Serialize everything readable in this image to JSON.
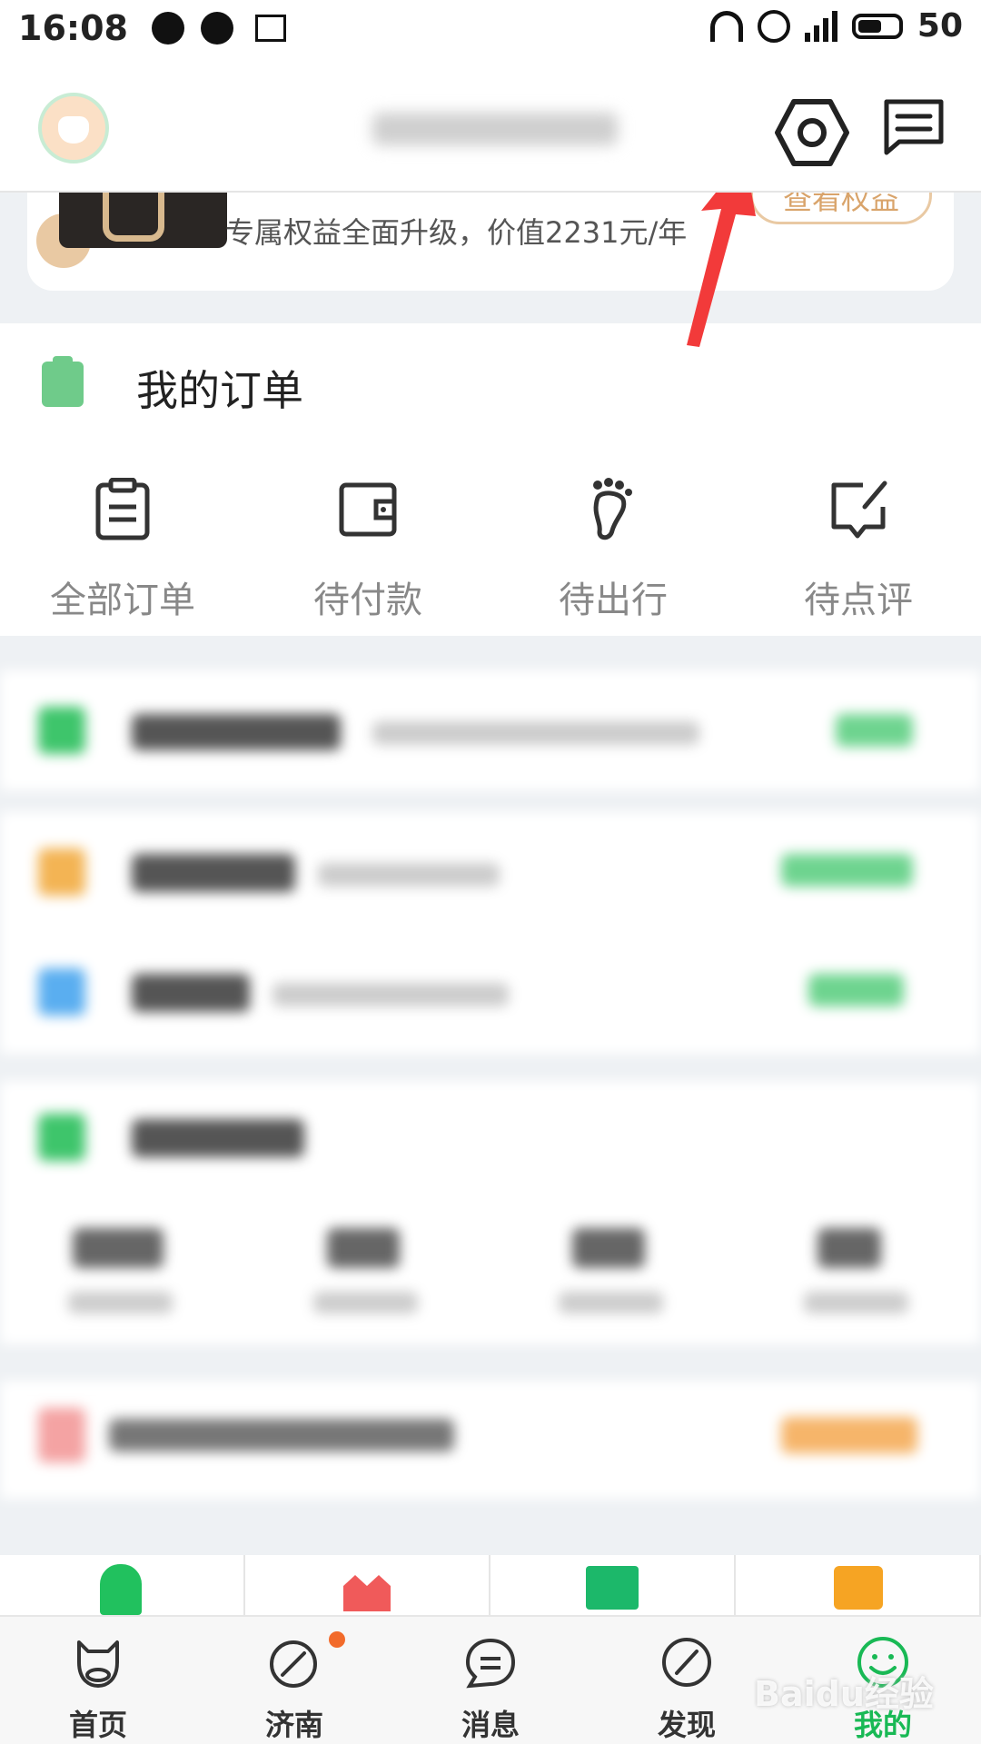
{
  "status_bar": {
    "time": "16:08",
    "battery": "50",
    "icons": [
      "wechat-icon",
      "wechat-icon",
      "news-icon",
      "headset-icon",
      "alarm-icon",
      "4g-signal-icon",
      "battery-icon"
    ]
  },
  "header": {
    "avatar_icon": "cow-avatar-icon",
    "settings_icon": "hexagon-settings-icon",
    "message_icon": "message-icon"
  },
  "vip_card": {
    "subtitle": "专属权益全面升级，价值2231元/年",
    "button": "查看权益"
  },
  "orders": {
    "title": "我的订单",
    "items": [
      {
        "label": "全部订单",
        "icon": "clipboard-icon"
      },
      {
        "label": "待付款",
        "icon": "wallet-icon"
      },
      {
        "label": "待出行",
        "icon": "footprint-icon"
      },
      {
        "label": "待点评",
        "icon": "comment-edit-icon"
      }
    ]
  },
  "tab_bar": {
    "items": [
      {
        "label": "首页",
        "icon": "cow-home-icon"
      },
      {
        "label": "济南",
        "icon": "compass-icon"
      },
      {
        "label": "消息",
        "icon": "chat-bubble-icon"
      },
      {
        "label": "发现",
        "icon": "discover-icon"
      },
      {
        "label": "我的",
        "icon": "smile-me-icon"
      }
    ],
    "active": "我的"
  },
  "watermark": "Baidu经验",
  "colors": {
    "accent": "#19b955",
    "gold": "#d9a46b",
    "arrow": "#f23a3a"
  }
}
